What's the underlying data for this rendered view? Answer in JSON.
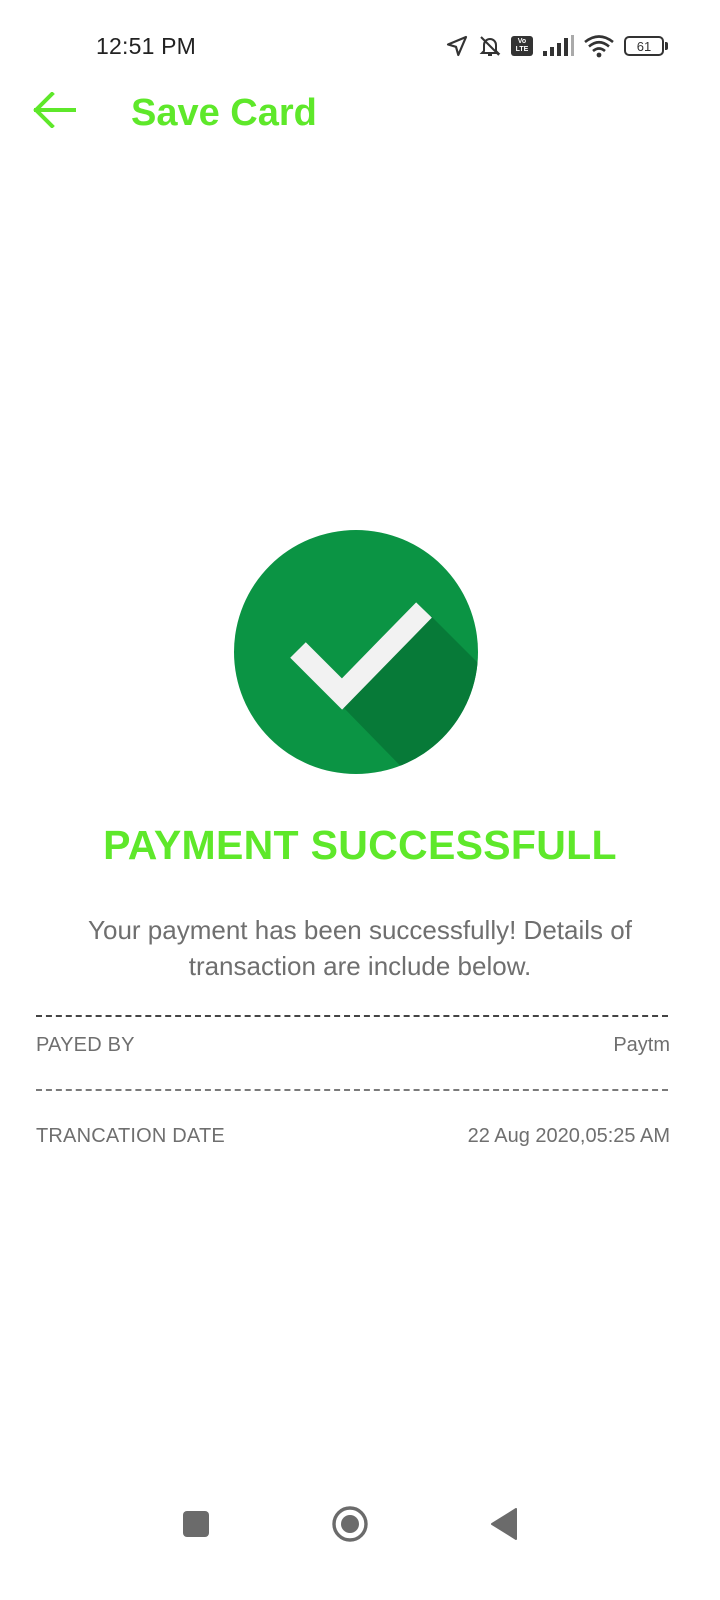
{
  "status_bar": {
    "time": "12:51 PM",
    "icons": [
      "location-arrow-icon",
      "bell-muted-icon",
      "volte-icon",
      "signal-icon",
      "wifi-icon",
      "battery-icon"
    ],
    "volte_top": "Vo",
    "volte_bottom": "LTE",
    "battery": "61"
  },
  "app_bar": {
    "back_icon": "arrow-left-icon",
    "title": "Save Card"
  },
  "colors": {
    "accent": "#5ee82a",
    "success_circle": "#0b9444",
    "success_shadow": "#077a38",
    "check": "#f2f2f2",
    "text_muted": "#6f6f6f"
  },
  "content": {
    "success_icon": "check-circle-icon",
    "headline": "PAYMENT SUCCESSFULL",
    "message": "Your payment has been successfully! Details of transaction are include below.",
    "details": [
      {
        "label": "PAYED BY",
        "value": "Paytm"
      },
      {
        "label": "TRANCATION DATE",
        "value": "22 Aug 2020,05:25 AM"
      }
    ]
  },
  "nav_bar": {
    "buttons": [
      "recents-square-icon",
      "home-circle-icon",
      "back-triangle-icon"
    ]
  }
}
